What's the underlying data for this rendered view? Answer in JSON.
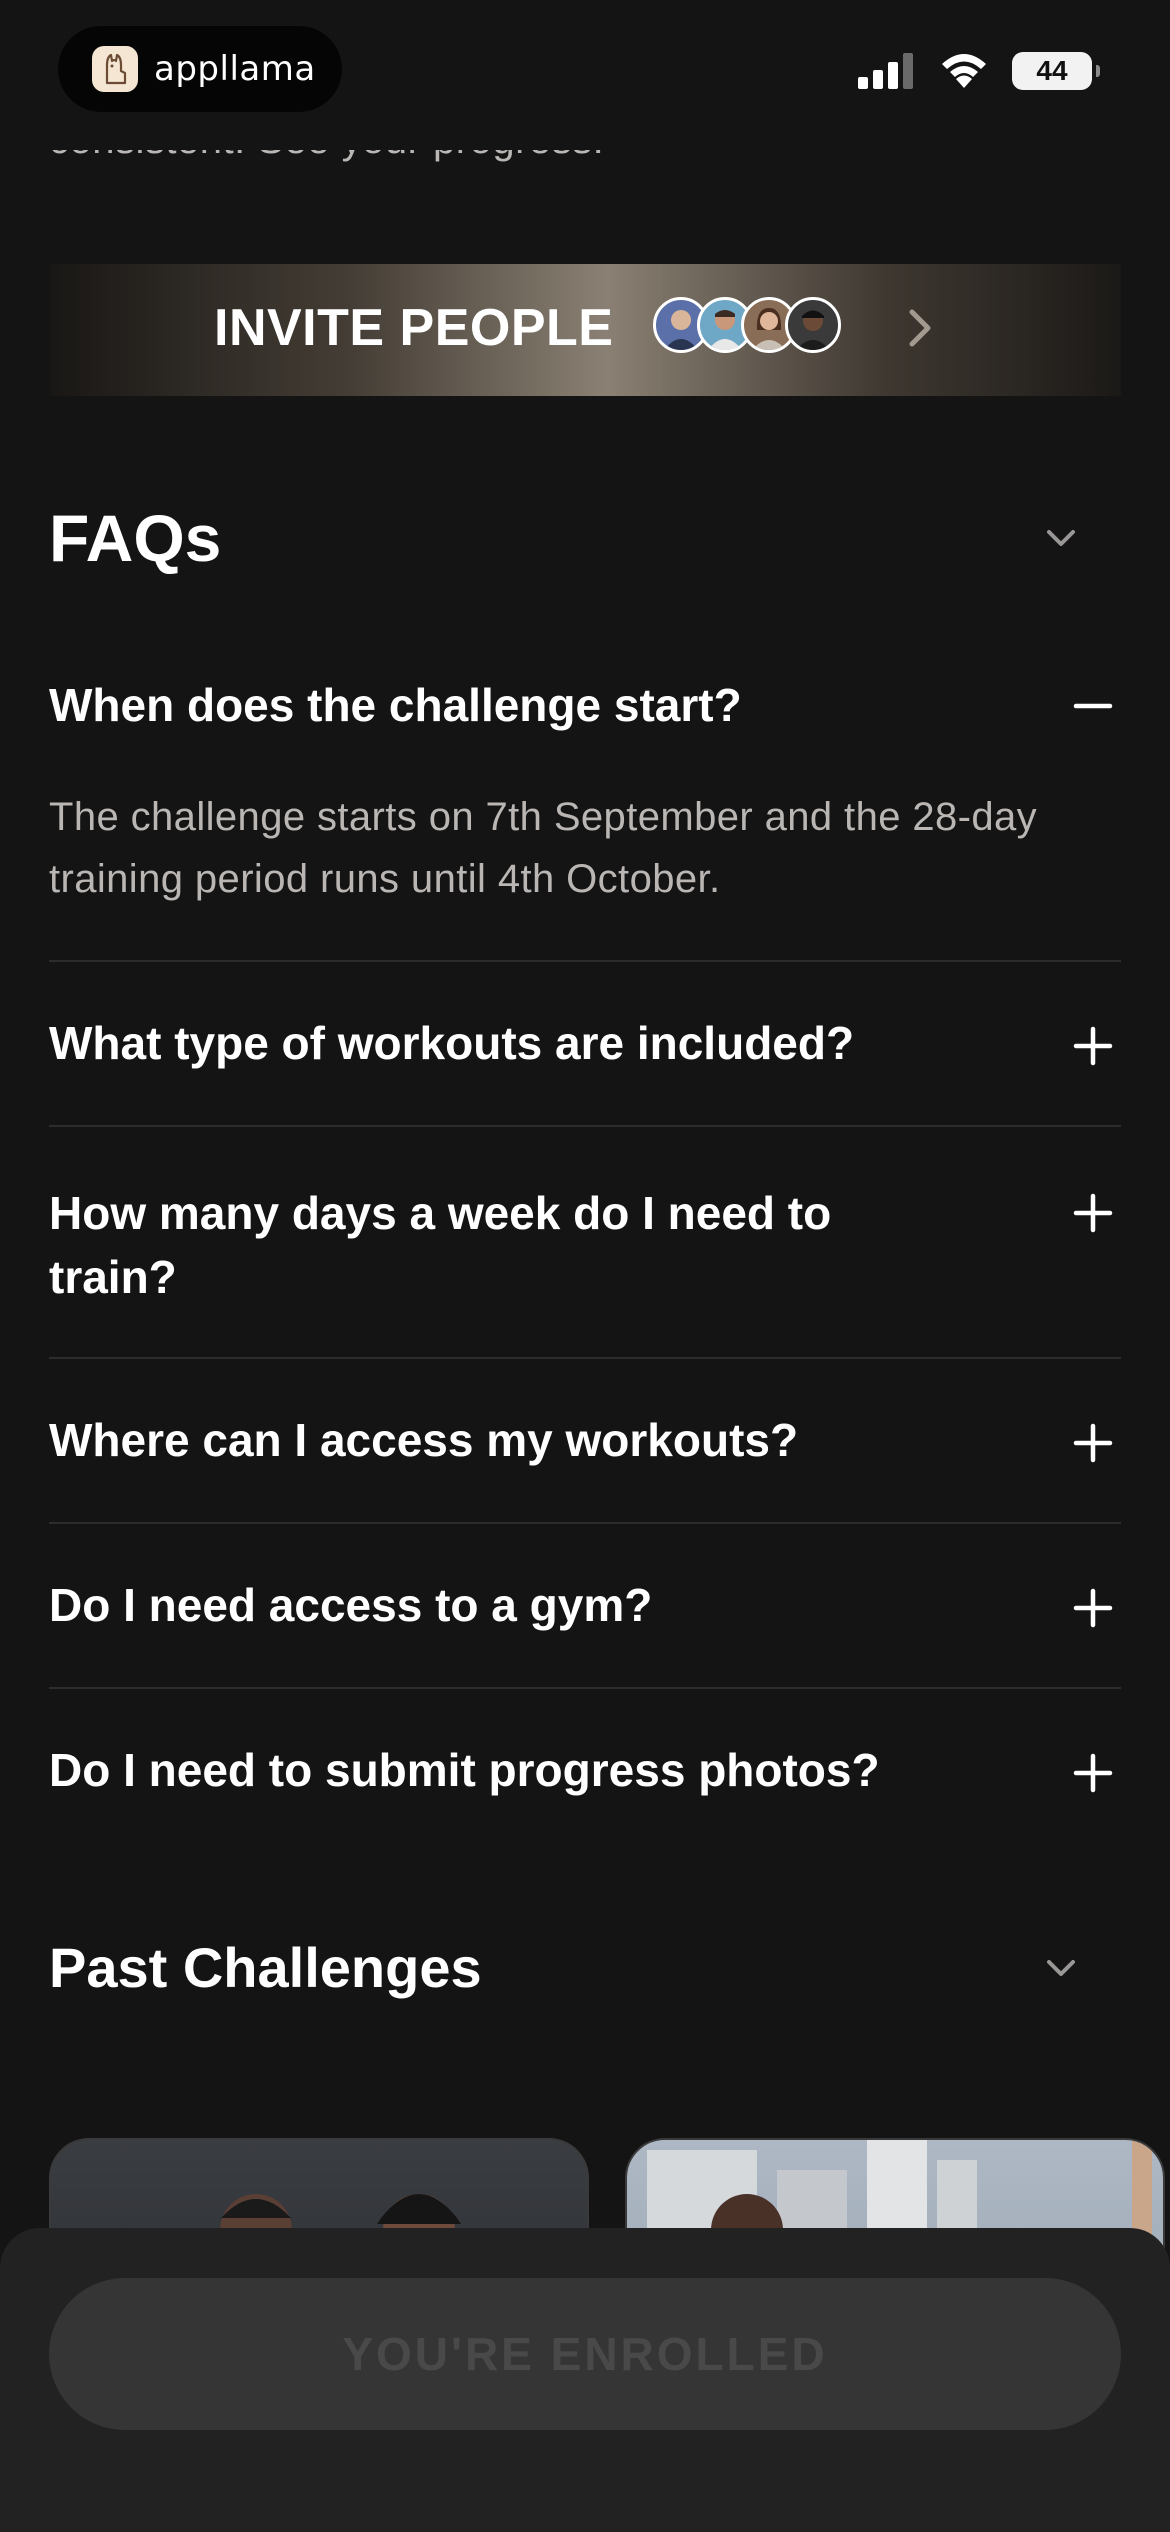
{
  "status_bar": {
    "brand": "appllama",
    "battery": "44"
  },
  "intro_text": "consistent. See your progress.",
  "invite": {
    "label": "INVITE PEOPLE"
  },
  "faq": {
    "title": "FAQs",
    "items": [
      {
        "question": "When does the challenge start?",
        "expanded": true,
        "answer": "The challenge starts on 7th September and the 28-day training period runs until 4th October."
      },
      {
        "question": "What type of workouts are included?",
        "expanded": false
      },
      {
        "question": "How many days a week do I need to train?",
        "expanded": false
      },
      {
        "question": "Where can I access my workouts?",
        "expanded": false
      },
      {
        "question": "Do I need access to a gym?",
        "expanded": false
      },
      {
        "question": "Do I need to submit progress photos?",
        "expanded": false
      }
    ]
  },
  "past_challenges": {
    "title": "Past Challenges"
  },
  "enroll_button": {
    "label": "YOU'RE ENROLLED"
  },
  "colors": {
    "background": "#151415",
    "primary_text": "#ffffff",
    "secondary_text": "#b9b6b3",
    "divider": "#2d2c2d",
    "button_disabled": "#363536"
  },
  "icons": {
    "brand": "llama-logo-icon",
    "signal": "cellular-signal-icon",
    "wifi": "wifi-icon",
    "invite_arrow": "chevron-right-icon",
    "section_toggle": "chevron-down-icon",
    "faq_collapse": "minus-icon",
    "faq_expand": "plus-icon"
  }
}
